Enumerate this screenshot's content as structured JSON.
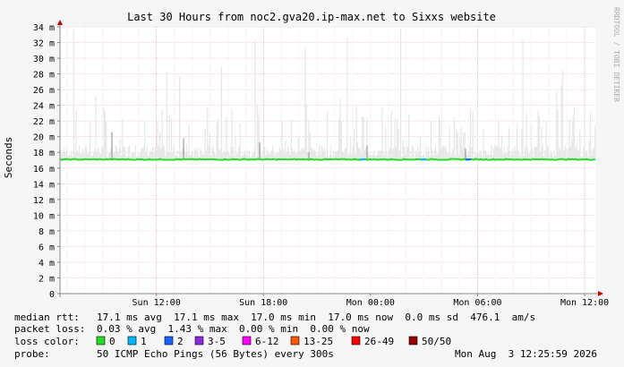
{
  "chart_data": {
    "type": "line",
    "title": "Last 30 Hours from noc2.gva20.ip-max.net to Sixxs website",
    "ylabel": "Seconds",
    "watermark": "RRDTOOL / TOBI OETIKER",
    "y_unit_suffix": "m",
    "ylim": [
      0,
      0.034
    ],
    "y_ticks": [
      "0",
      "2 m",
      "4 m",
      "6 m",
      "8 m",
      "10 m",
      "12 m",
      "14 m",
      "16 m",
      "18 m",
      "20 m",
      "22 m",
      "24 m",
      "26 m",
      "28 m",
      "30 m",
      "32 m",
      "34 m"
    ],
    "x_ticks": [
      "Sun 12:00",
      "Sun 18:00",
      "Mon 00:00",
      "Mon 06:00",
      "Mon 12:00"
    ],
    "x_range_hours": 30,
    "series": [
      {
        "name": "median rtt",
        "value_ms": 17.1,
        "color": "#22dd22"
      }
    ],
    "colors": {
      "background": "#f6f6f6",
      "plot_bg": "#ffffff",
      "grid": "#e7b8b8",
      "axis": "#888888",
      "arrow": "#cc0000",
      "smoke_light": "#e6e6e6",
      "smoke_dark": "#8a8a8a"
    }
  },
  "legend": {
    "median_rtt_label": "median rtt:",
    "median_rtt_text": "17.1 ms avg  17.1 ms max  17.0 ms min  17.0 ms now  0.0 ms sd  476.1  am/s",
    "packet_loss_label": "packet loss:",
    "packet_loss_text": "0.03 % avg  1.43 % max  0.00 % min  0.00 % now",
    "loss_color_label": "loss color:",
    "loss_colors": [
      {
        "label": "0",
        "color": "#22dd22"
      },
      {
        "label": "1",
        "color": "#00b8ff"
      },
      {
        "label": "2",
        "color": "#1862ff"
      },
      {
        "label": "3-5",
        "color": "#8a2be2"
      },
      {
        "label": "6-12",
        "color": "#ff00ff"
      },
      {
        "label": "13-25",
        "color": "#ff5500"
      },
      {
        "label": "26-49",
        "color": "#ff0000"
      },
      {
        "label": "50/50",
        "color": "#990000"
      }
    ],
    "probe_label": "probe:",
    "probe_text": "50 ICMP Echo Pings (56 Bytes) every 300s",
    "timestamp": "Mon Aug  3 12:25:59 2026"
  }
}
